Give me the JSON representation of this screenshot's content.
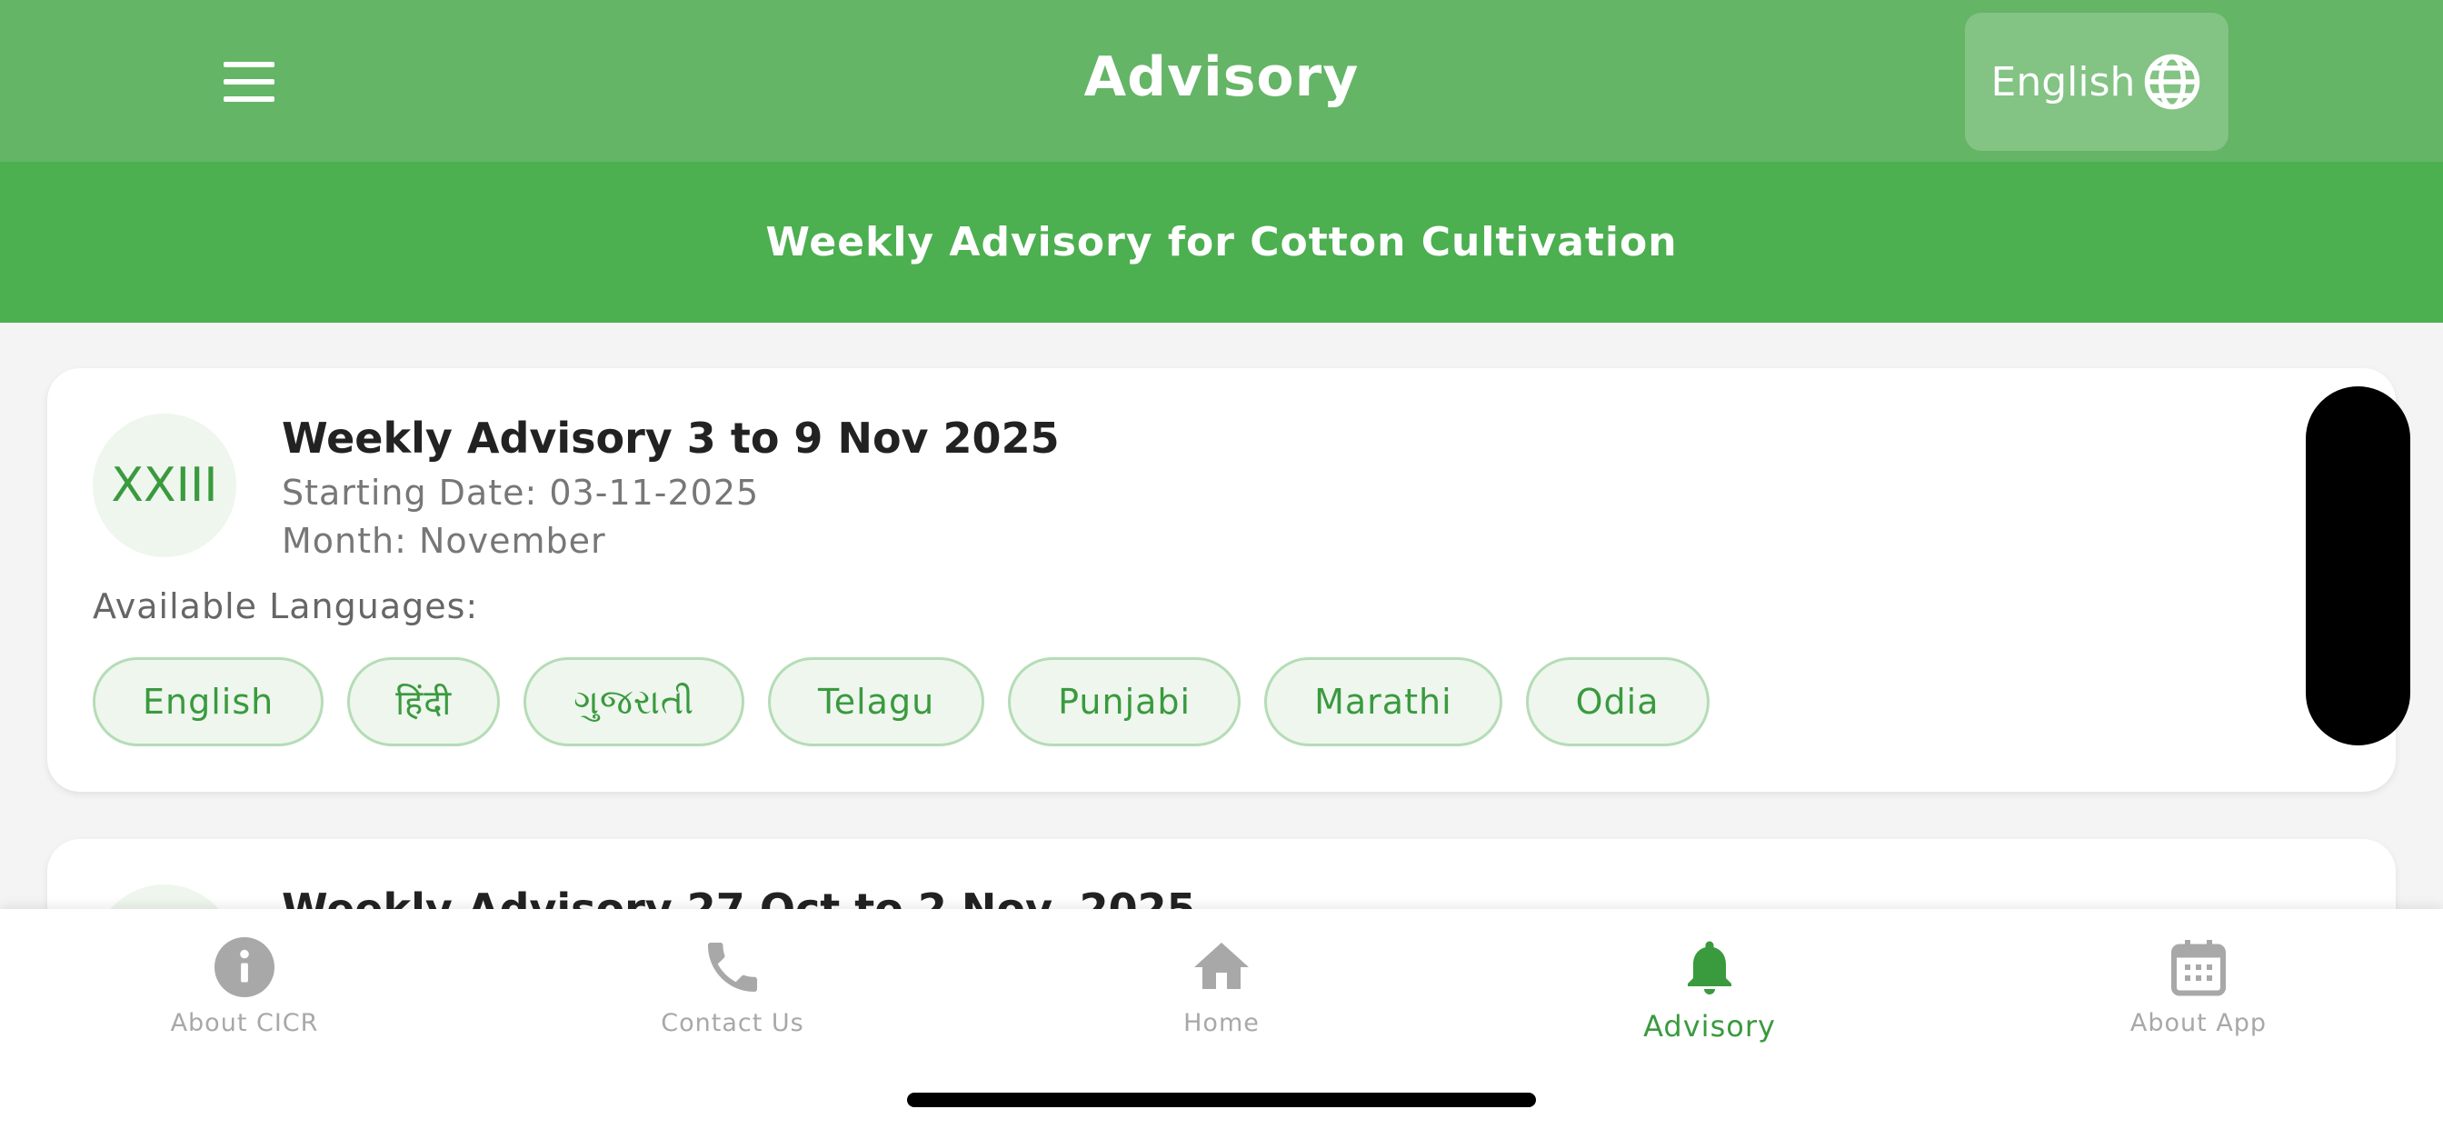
{
  "app_bar": {
    "title": "Advisory",
    "language_button": "English"
  },
  "sub_header": {
    "title": "Weekly Advisory for Cotton Cultivation"
  },
  "advisories": [
    {
      "badge": "XXIII",
      "title": "Weekly Advisory 3 to 9 Nov 2025",
      "starting_date": "Starting Date: 03-11-2025",
      "month": "Month: November",
      "languages_label": "Available Languages:",
      "languages": [
        "English",
        "हिंदी",
        "ગુજરાતી",
        "Telagu",
        "Punjabi",
        "Marathi",
        "Odia"
      ]
    },
    {
      "title": "Weekly Advisory 27 Oct to 2 Nov, 2025"
    }
  ],
  "bottom_nav": [
    {
      "label": "About CICR",
      "icon": "info-icon",
      "active": false
    },
    {
      "label": "Contact Us",
      "icon": "phone-icon",
      "active": false
    },
    {
      "label": "Home",
      "icon": "home-icon",
      "active": false
    },
    {
      "label": "Advisory",
      "icon": "bell-icon",
      "active": true
    },
    {
      "label": "About App",
      "icon": "calendar-icon",
      "active": false
    }
  ],
  "colors": {
    "app_bar": "#64b566",
    "sub_header": "#4caf50",
    "accent": "#3a9a3e",
    "inactive": "#a8a8a8"
  }
}
